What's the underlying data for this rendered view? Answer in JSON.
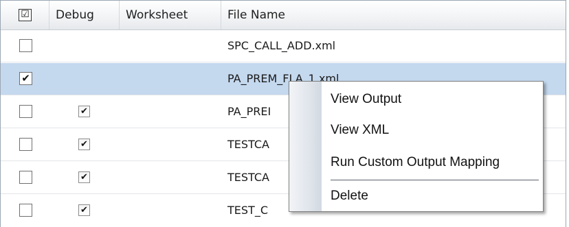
{
  "grid": {
    "columns": {
      "select_all": "☑",
      "debug": "Debug",
      "worksheet": "Worksheet",
      "file_name": "File Name"
    },
    "rows": [
      {
        "selected_mark": "",
        "debug_mark": "",
        "worksheet": "",
        "file_name": "SPC_CALL_ADD.xml",
        "row_selected": false,
        "has_debug": false
      },
      {
        "selected_mark": "✔",
        "debug_mark": "",
        "worksheet": "",
        "file_name": "PA_PREM_FLA_1.xml",
        "row_selected": true,
        "has_debug": false
      },
      {
        "selected_mark": "",
        "debug_mark": "✔",
        "worksheet": "",
        "file_name": "PA_PREI",
        "row_selected": false,
        "has_debug": true
      },
      {
        "selected_mark": "",
        "debug_mark": "✔",
        "worksheet": "",
        "file_name": "TESTCA",
        "row_selected": false,
        "has_debug": true
      },
      {
        "selected_mark": "",
        "debug_mark": "✔",
        "worksheet": "",
        "file_name": "TESTCA",
        "row_selected": false,
        "has_debug": true
      },
      {
        "selected_mark": "",
        "debug_mark": "✔",
        "worksheet": "",
        "file_name": "TEST_C",
        "row_selected": false,
        "has_debug": true
      }
    ]
  },
  "context_menu": {
    "items": [
      "View Output",
      "View XML",
      "Run Custom Output Mapping",
      "Delete"
    ]
  },
  "colors": {
    "selected_row": "#c4d8ee",
    "header_bg": "#eef0f3",
    "menu_gutter": "#dfe4ea"
  }
}
